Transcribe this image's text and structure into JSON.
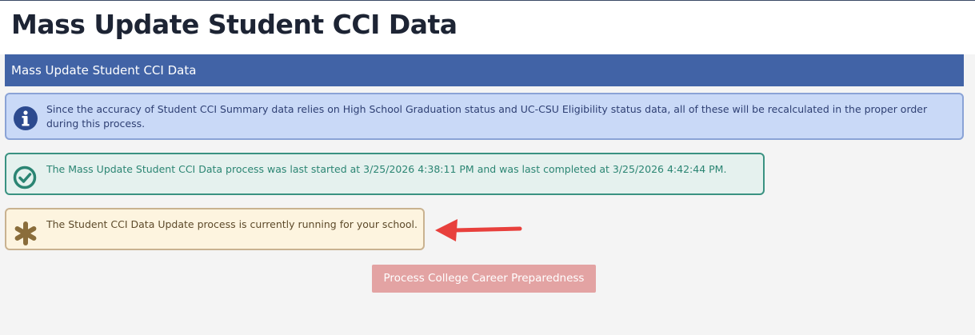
{
  "page": {
    "title": "Mass Update Student CCI Data"
  },
  "section": {
    "header": "Mass Update Student CCI Data"
  },
  "alerts": {
    "info": {
      "icon": "info-icon",
      "text": "Since the accuracy of Student CCI Summary data relies on High School Graduation status and UC-CSU Eligibility status data, all of these will be recalculated in the proper order during this process."
    },
    "success": {
      "icon": "check-circle-icon",
      "text": "The Mass Update Student CCI Data process was last started at 3/25/2026 4:38:11 PM and was last completed at 3/25/2026 4:42:44 PM."
    },
    "warning": {
      "icon": "asterisk-icon",
      "text": "The Student CCI Data Update process is currently running for your school."
    }
  },
  "actions": {
    "process_label": "Process College Career Preparedness",
    "process_disabled": true
  },
  "colors": {
    "header_bg": "#4163a6",
    "info_bg": "#c9d9f7",
    "success_border": "#3a9281",
    "warning_bg": "#fdf4df",
    "button_bg": "#e3a3a3",
    "annotation_arrow": "#e8403c"
  }
}
